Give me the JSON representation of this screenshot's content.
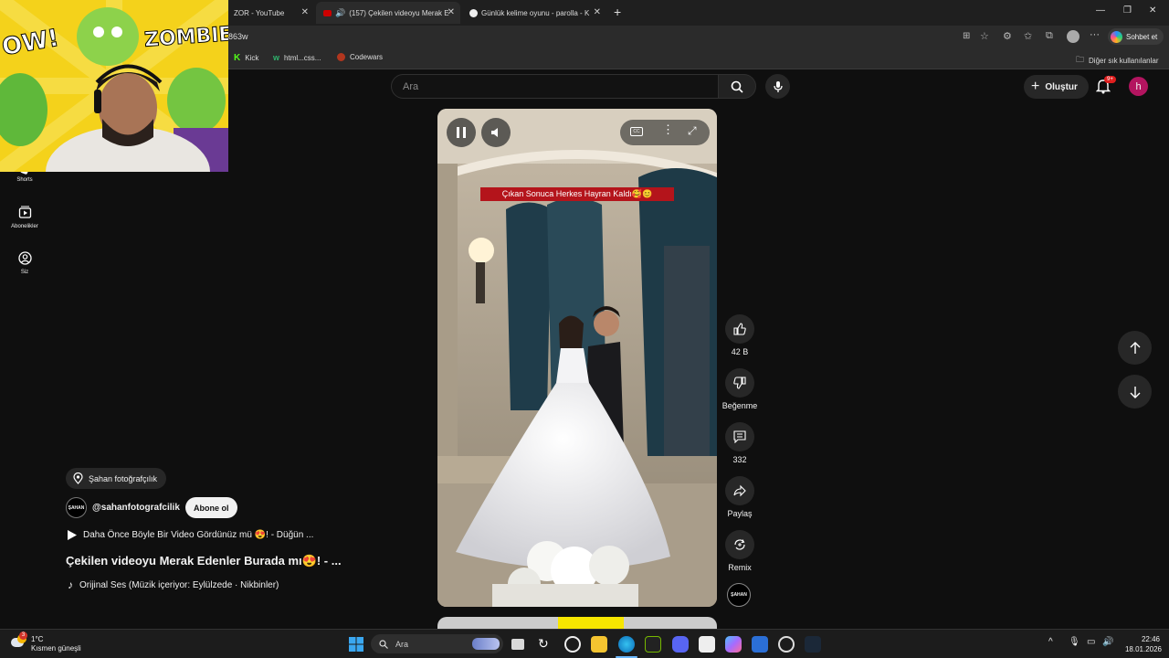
{
  "browser": {
    "tabs": [
      {
        "title": "ZOR - YouTube",
        "active": false
      },
      {
        "title": "(157) Çekilen videoyu Merak E",
        "active": true
      },
      {
        "title": "Günlük kelime oyunu - parolla - K",
        "active": false
      }
    ],
    "address": "863w",
    "profile_button": "Sohbet et",
    "bookmarks": [
      "Kick",
      "html...css...",
      "Codewars"
    ],
    "bookmarks_other": "Diğer sık kullanılanlar"
  },
  "youtube": {
    "search_placeholder": "Ara",
    "create_label": "Oluştur",
    "notif_badge": "9+",
    "avatar_letter": "h",
    "sidebar": [
      {
        "label": "Shorts",
        "icon": "shorts-icon"
      },
      {
        "label": "Abonelikler",
        "icon": "subscriptions-icon"
      },
      {
        "label": "Siz",
        "icon": "you-icon"
      }
    ],
    "short": {
      "overlay_caption": "Çıkan Sonuca Herkes Hayran Kaldı🥰😊",
      "location_tag": "Şahan fotoğrafçılık",
      "channel_handle": "@sahanfotografcilik",
      "channel_avatar_text": "ŞAHAN",
      "subscribe_label": "Abone ol",
      "playlist_title": "Daha Önce Böyle Bir Video Gördünüz mü 😍! - Düğün ...",
      "title": "Çekilen videoyu  Merak Edenler Burada mı😍! - ...",
      "audio": "Orijinal Ses (Müzik içeriyor: Eylülzede · Nikbinler)"
    },
    "actions": {
      "like_count": "42 B",
      "dislike_label": "Beğenme",
      "comment_count": "332",
      "share_label": "Paylaş",
      "remix_label": "Remix"
    }
  },
  "webcam": {
    "text_left": "OW!",
    "text_right": "ZOMBIE!"
  },
  "taskbar": {
    "weather_temp": "1°C",
    "weather_desc": "Kısmen güneşli",
    "weather_badge": "3",
    "search_label": "Ara",
    "time": "22:46",
    "date": "18.01.2026"
  },
  "colors": {
    "background": "#0f0f0f",
    "accent_red": "#cc0000",
    "notif_red": "#e01e1e",
    "avatar_purple": "#b3145f"
  }
}
